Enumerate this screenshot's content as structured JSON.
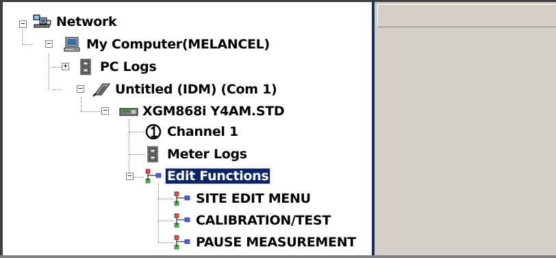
{
  "tree": {
    "network": "Network",
    "computer": "My Computer(MELANCEL)",
    "pc_logs": "PC Logs",
    "untitled": "Untitled (IDM) (Com 1)",
    "meter": "XGM868i Y4AM.STD",
    "channel1": "Channel 1",
    "meter_logs": "Meter Logs",
    "edit_functions": "Edit Functions",
    "site_edit": "SITE EDIT MENU",
    "calibration": "CALIBRATION/TEST",
    "pause": "PAUSE MEASUREMENT"
  },
  "expanders": {
    "minus": "−",
    "plus": "+"
  },
  "icons": {
    "network": "network-icon",
    "computer": "computer-icon",
    "log": "log-cabinet-icon",
    "serial": "serial-cable-icon",
    "meter": "meter-device-icon",
    "channel": "channel-one-icon",
    "function": "function-tree-icon"
  },
  "colors": {
    "selection": "#0a246a",
    "pane_border": "#1a2f66",
    "background": "#d4d0c8"
  }
}
